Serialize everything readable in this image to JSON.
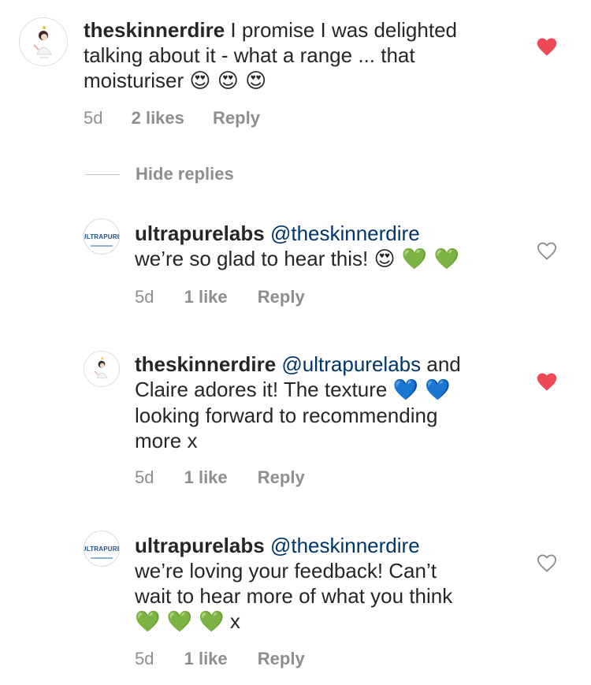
{
  "comments": [
    {
      "username": "theskinnerdire",
      "mention": "",
      "text_line1": "I promise I was delighted",
      "text_line2": "talking about it - what a range ... that",
      "text_line3": "moisturiser",
      "emojis": "😍 😍 😍",
      "time": "5d",
      "likes": "2 likes",
      "reply": "Reply",
      "liked": true
    },
    {
      "username": "ultrapurelabs",
      "mention": "@theskinnerdire",
      "text_line1": "we’re so glad to hear this!",
      "emojis": "😍 💚 💚",
      "time": "5d",
      "likes": "1 like",
      "reply": "Reply",
      "liked": false
    },
    {
      "username": "theskinnerdire",
      "mention": "@ultrapurelabs",
      "text_after_mention": "and",
      "text_line2": "Claire adores it! The texture",
      "emojis": "💙 💙",
      "text_line3": "looking forward to recommending",
      "text_line4": "more x",
      "time": "5d",
      "likes": "1 like",
      "reply": "Reply",
      "liked": true
    },
    {
      "username": "ultrapurelabs",
      "mention": "@theskinnerdire",
      "text_line2": "we’re loving your feedback! Can’t",
      "text_line3": "wait to hear more of what you think",
      "emojis": "💚 💚 💚",
      "text_tail": "x",
      "time": "5d",
      "likes": "1 like",
      "reply": "Reply",
      "liked": false
    }
  ],
  "hide_replies": "Hide replies",
  "avatar_logo_text": "ULTRAPURE",
  "colors": {
    "liked_heart": "#ed4956",
    "unliked_heart_stroke": "#8e8e8e",
    "mention": "#003569",
    "meta_text": "#8e8e8e"
  },
  "icons": {
    "liked": "heart-filled-icon",
    "unliked": "heart-outline-icon"
  }
}
